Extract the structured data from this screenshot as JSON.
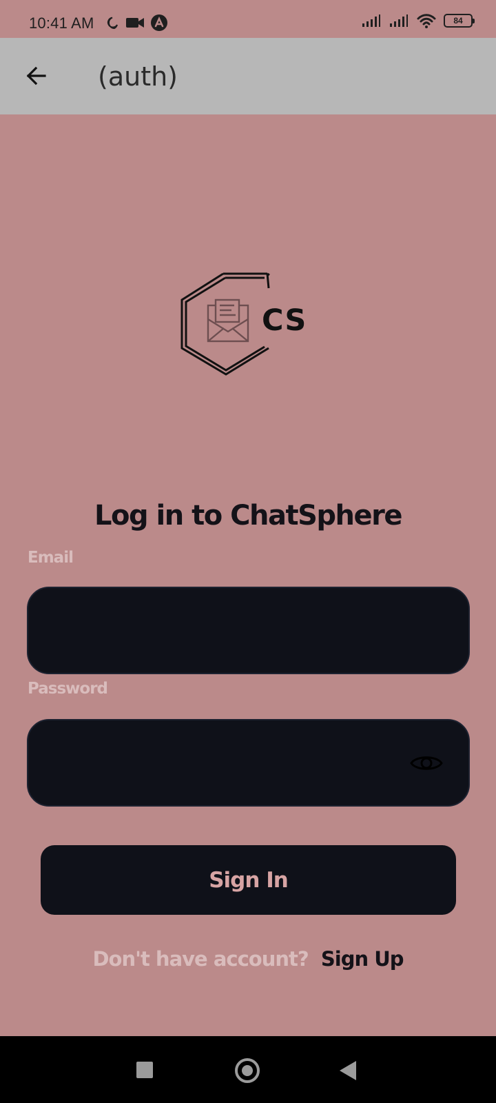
{
  "status_bar": {
    "time": "10:41 AM",
    "battery": "84",
    "icons": [
      "moon-icon",
      "video-icon",
      "notification-icon",
      "signal-icon",
      "signal-icon",
      "wifi-icon",
      "battery-icon"
    ]
  },
  "header": {
    "title": "(auth)",
    "back_icon": "back-arrow-icon"
  },
  "logo": {
    "text": "CS",
    "icon": "envelope-icon"
  },
  "login": {
    "title": "Log in to ChatSphere",
    "email_label": "Email",
    "email_value": "",
    "password_label": "Password",
    "password_value": "",
    "password_toggle_icon": "eye-icon",
    "sign_in_label": "Sign In",
    "signup_prompt": "Don't have account?",
    "signup_link": "Sign Up"
  },
  "navigation": {
    "recent_icon": "square-icon",
    "home_icon": "circle-icon",
    "back_icon": "back-triangle-icon"
  },
  "colors": {
    "background": "#bb8a8a",
    "header": "#b7b7b7",
    "input": "#0f1119",
    "muted_text": "#d9bcbc",
    "dark_text": "#141218",
    "button_text": "#d7a4a4"
  }
}
